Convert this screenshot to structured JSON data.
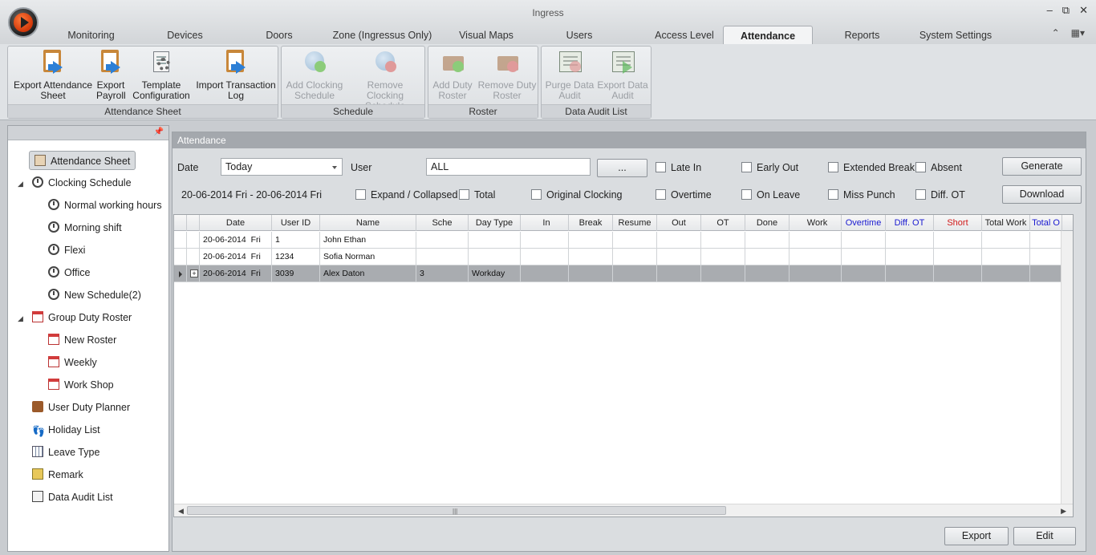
{
  "window": {
    "title": "Ingress"
  },
  "tabs": [
    "Monitoring",
    "Devices",
    "Doors",
    "Zone (Ingressus Only)",
    "Visual Maps",
    "Users",
    "Access Level",
    "Attendance",
    "Reports",
    "System Settings"
  ],
  "active_tab": "Attendance",
  "ribbon": {
    "groups": [
      {
        "label": "Attendance Sheet",
        "buttons": [
          {
            "line1": "Export Attendance",
            "line2": "Sheet",
            "icon": "export-attendance-icon",
            "enabled": true
          },
          {
            "line1": "Export",
            "line2": "Payroll",
            "icon": "export-payroll-icon",
            "enabled": true
          },
          {
            "line1": "Template",
            "line2": "Configuration",
            "icon": "template-config-icon",
            "enabled": true
          },
          {
            "line1": "Import Transaction",
            "line2": "Log",
            "icon": "import-log-icon",
            "enabled": true
          }
        ]
      },
      {
        "label": "Schedule",
        "buttons": [
          {
            "line1": "Add Clocking",
            "line2": "Schedule",
            "icon": "add-schedule-icon",
            "enabled": false
          },
          {
            "line1": "Remove Clocking",
            "line2": "Schedule",
            "icon": "remove-schedule-icon",
            "enabled": false
          }
        ]
      },
      {
        "label": "Roster",
        "buttons": [
          {
            "line1": "Add Duty",
            "line2": "Roster",
            "icon": "add-roster-icon",
            "enabled": false
          },
          {
            "line1": "Remove Duty",
            "line2": "Roster",
            "icon": "remove-roster-icon",
            "enabled": false
          }
        ]
      },
      {
        "label": "Data Audit List",
        "buttons": [
          {
            "line1": "Purge Data",
            "line2": "Audit",
            "icon": "purge-audit-icon",
            "enabled": false
          },
          {
            "line1": "Export Data",
            "line2": "Audit",
            "icon": "export-audit-icon",
            "enabled": false
          }
        ]
      }
    ]
  },
  "tree": [
    {
      "label": "Attendance Sheet",
      "icon": "clipboard-icon",
      "selected": true
    },
    {
      "label": "Clocking Schedule",
      "icon": "clock-icon",
      "expanded": true
    },
    {
      "label": "Normal working hours",
      "icon": "clock-icon"
    },
    {
      "label": "Morning shift",
      "icon": "clock-icon"
    },
    {
      "label": "Flexi",
      "icon": "clock-icon"
    },
    {
      "label": "Office",
      "icon": "clock-icon"
    },
    {
      "label": "New Schedule(2)",
      "icon": "clock-icon"
    },
    {
      "label": "Group Duty Roster",
      "icon": "calendar-icon",
      "expanded": true
    },
    {
      "label": "New Roster",
      "icon": "calendar-icon"
    },
    {
      "label": "Weekly",
      "icon": "calendar-icon"
    },
    {
      "label": "Work Shop",
      "icon": "calendar-icon"
    },
    {
      "label": "User Duty Planner",
      "icon": "briefcase-icon"
    },
    {
      "label": "Holiday List",
      "icon": "footprints-icon"
    },
    {
      "label": "Leave Type",
      "icon": "grid-icon"
    },
    {
      "label": "Remark",
      "icon": "remark-icon"
    },
    {
      "label": "Data Audit List",
      "icon": "audit-icon"
    }
  ],
  "main": {
    "header": "Attendance",
    "date_label": "Date",
    "date_value": "Today",
    "user_label": "User",
    "user_value": "ALL",
    "browse_label": "...",
    "range_text": "20-06-2014 Fri - 20-06-2014 Fri",
    "checkboxes_row1": [
      "Late In",
      "Early Out",
      "Extended Break",
      "Absent"
    ],
    "checkboxes_row2": [
      "Expand / Collapsed",
      "Total",
      "Original Clocking",
      "Overtime",
      "On Leave",
      "Miss Punch",
      "Diff. OT"
    ],
    "generate_label": "Generate",
    "download_label": "Download",
    "export_label": "Export",
    "edit_label": "Edit"
  },
  "table": {
    "columns": [
      "Date",
      "User ID",
      "Name",
      "Sche",
      "Day Type",
      "In",
      "Break",
      "Resume",
      "Out",
      "OT",
      "Done",
      "Work",
      "Overtime",
      "Diff. OT",
      "Short",
      "Total Work",
      "Total O"
    ],
    "column_colors": {
      "Overtime": "#1a1ad0",
      "Diff. OT": "#1a1ad0",
      "Short": "#d01a1a",
      "Total O": "#1a1ad0"
    },
    "rows": [
      {
        "date": "20-06-2014",
        "day": "Fri",
        "user_id": "1",
        "name": "John Ethan",
        "sche": "",
        "day_type": "",
        "selected": false
      },
      {
        "date": "20-06-2014",
        "day": "Fri",
        "user_id": "1234",
        "name": "Sofia Norman",
        "sche": "",
        "day_type": "",
        "selected": false
      },
      {
        "date": "20-06-2014",
        "day": "Fri",
        "user_id": "3039",
        "name": "Alex Daton",
        "sche": "3",
        "day_type": "Workday",
        "selected": true
      }
    ]
  }
}
